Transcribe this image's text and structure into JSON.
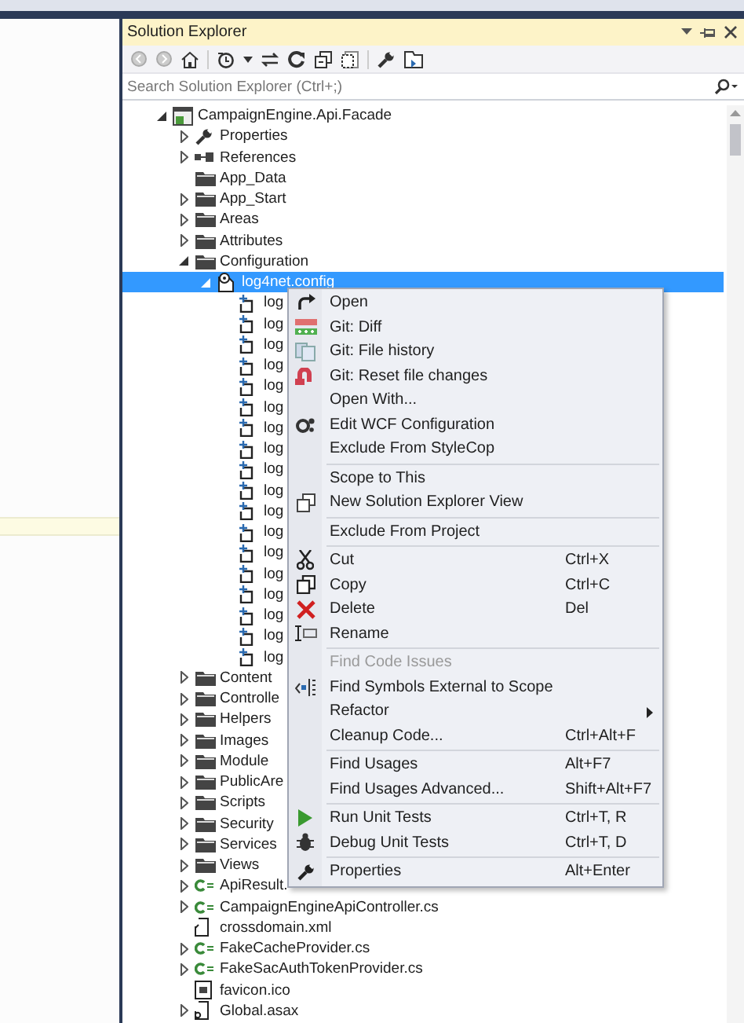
{
  "panel": {
    "title": "Solution Explorer",
    "search": {
      "placeholder": "Search Solution Explorer (Ctrl+;)"
    }
  },
  "tree": [
    {
      "label": "CampaignEngine.Api.Facade",
      "kind": "project",
      "expanded": true,
      "selected": false,
      "children": [
        {
          "label": "Properties",
          "kind": "properties",
          "expanded": false,
          "selected": false
        },
        {
          "label": "References",
          "kind": "references",
          "expanded": false,
          "selected": false
        },
        {
          "label": "App_Data",
          "kind": "folder",
          "selected": false
        },
        {
          "label": "App_Start",
          "kind": "folder",
          "expanded": false,
          "selected": false
        },
        {
          "label": "Areas",
          "kind": "folder",
          "expanded": false,
          "selected": false
        },
        {
          "label": "Attributes",
          "kind": "folder",
          "expanded": false,
          "selected": false
        },
        {
          "label": "Configuration",
          "kind": "folder",
          "expanded": true,
          "selected": false,
          "children": [
            {
              "label": "log4net.config",
              "kind": "config",
              "expanded": true,
              "selected": true,
              "children": [
                {
                  "label": "log",
                  "kind": "config-child",
                  "selected": false
                },
                {
                  "label": "log",
                  "kind": "config-child",
                  "selected": false
                },
                {
                  "label": "log",
                  "kind": "config-child",
                  "selected": false
                },
                {
                  "label": "log",
                  "kind": "config-child",
                  "selected": false
                },
                {
                  "label": "log",
                  "kind": "config-child",
                  "selected": false
                },
                {
                  "label": "log",
                  "kind": "config-child",
                  "selected": false
                },
                {
                  "label": "log",
                  "kind": "config-child",
                  "selected": false
                },
                {
                  "label": "log",
                  "kind": "config-child",
                  "selected": false
                },
                {
                  "label": "log",
                  "kind": "config-child",
                  "selected": false
                },
                {
                  "label": "log",
                  "kind": "config-child",
                  "selected": false
                },
                {
                  "label": "log",
                  "kind": "config-child",
                  "selected": false
                },
                {
                  "label": "log",
                  "kind": "config-child",
                  "selected": false
                },
                {
                  "label": "log",
                  "kind": "config-child",
                  "selected": false
                },
                {
                  "label": "log",
                  "kind": "config-child",
                  "selected": false
                },
                {
                  "label": "log",
                  "kind": "config-child",
                  "selected": false
                },
                {
                  "label": "log",
                  "kind": "config-child",
                  "selected": false
                },
                {
                  "label": "log",
                  "kind": "config-child",
                  "selected": false
                },
                {
                  "label": "log",
                  "kind": "config-child",
                  "selected": false
                }
              ]
            }
          ]
        },
        {
          "label": "Content",
          "kind": "folder",
          "expanded": false,
          "selected": false
        },
        {
          "label": "Controlle",
          "kind": "folder",
          "expanded": false,
          "selected": false
        },
        {
          "label": "Helpers",
          "kind": "folder",
          "expanded": false,
          "selected": false
        },
        {
          "label": "Images",
          "kind": "folder",
          "expanded": false,
          "selected": false
        },
        {
          "label": "Module",
          "kind": "folder",
          "expanded": false,
          "selected": false
        },
        {
          "label": "PublicAre",
          "kind": "folder",
          "expanded": false,
          "selected": false
        },
        {
          "label": "Scripts",
          "kind": "folder",
          "expanded": false,
          "selected": false
        },
        {
          "label": "Security",
          "kind": "folder",
          "expanded": false,
          "selected": false
        },
        {
          "label": "Services",
          "kind": "folder",
          "expanded": false,
          "selected": false
        },
        {
          "label": "Views",
          "kind": "folder",
          "expanded": false,
          "selected": false
        },
        {
          "label": "ApiResult.",
          "kind": "csharp",
          "expanded": false,
          "selected": false
        },
        {
          "label": "CampaignEngineApiController.cs",
          "kind": "csharp",
          "expanded": false,
          "selected": false
        },
        {
          "label": "crossdomain.xml",
          "kind": "xml",
          "selected": false
        },
        {
          "label": "FakeCacheProvider.cs",
          "kind": "csharp",
          "expanded": false,
          "selected": false
        },
        {
          "label": "FakeSacAuthTokenProvider.cs",
          "kind": "csharp",
          "expanded": false,
          "selected": false
        },
        {
          "label": "favicon.ico",
          "kind": "ico",
          "selected": false
        },
        {
          "label": "Global.asax",
          "kind": "asax",
          "expanded": false,
          "selected": false
        }
      ]
    }
  ],
  "context_menu": [
    {
      "kind": "item",
      "label": "Open",
      "disabled": false
    },
    {
      "kind": "item",
      "label": "Git: Diff",
      "disabled": false
    },
    {
      "kind": "item",
      "label": "Git: File history",
      "disabled": false
    },
    {
      "kind": "item",
      "label": "Git: Reset file changes",
      "disabled": false
    },
    {
      "kind": "item",
      "label": "Open With...",
      "disabled": false
    },
    {
      "kind": "item",
      "label": "Edit WCF Configuration",
      "disabled": false
    },
    {
      "kind": "item",
      "label": "Exclude From StyleCop",
      "disabled": false
    },
    {
      "kind": "separator"
    },
    {
      "kind": "item",
      "label": "Scope to This",
      "disabled": false
    },
    {
      "kind": "item",
      "label": "New Solution Explorer View",
      "disabled": false
    },
    {
      "kind": "separator"
    },
    {
      "kind": "item",
      "label": "Exclude From Project",
      "disabled": false
    },
    {
      "kind": "separator"
    },
    {
      "kind": "item",
      "label": "Cut",
      "shortcut": "Ctrl+X",
      "disabled": false
    },
    {
      "kind": "item",
      "label": "Copy",
      "shortcut": "Ctrl+C",
      "disabled": false
    },
    {
      "kind": "item",
      "label": "Delete",
      "shortcut": "Del",
      "disabled": false
    },
    {
      "kind": "item",
      "label": "Rename",
      "disabled": false
    },
    {
      "kind": "separator"
    },
    {
      "kind": "item",
      "label": "Find Code Issues",
      "disabled": true
    },
    {
      "kind": "item",
      "label": "Find Symbols External to Scope",
      "disabled": false
    },
    {
      "kind": "item",
      "label": "Refactor",
      "submenu": true,
      "disabled": false
    },
    {
      "kind": "item",
      "label": "Cleanup Code...",
      "shortcut": "Ctrl+Alt+F",
      "disabled": false
    },
    {
      "kind": "separator"
    },
    {
      "kind": "item",
      "label": "Find Usages",
      "shortcut": "Alt+F7",
      "disabled": false
    },
    {
      "kind": "item",
      "label": "Find Usages Advanced...",
      "shortcut": "Shift+Alt+F7",
      "disabled": false
    },
    {
      "kind": "separator"
    },
    {
      "kind": "item",
      "label": "Run Unit Tests",
      "shortcut": "Ctrl+T, R",
      "disabled": false
    },
    {
      "kind": "item",
      "label": "Debug Unit Tests",
      "shortcut": "Ctrl+T, D",
      "disabled": false
    },
    {
      "kind": "separator"
    },
    {
      "kind": "item",
      "label": "Properties",
      "shortcut": "Alt+Enter",
      "disabled": false
    }
  ]
}
